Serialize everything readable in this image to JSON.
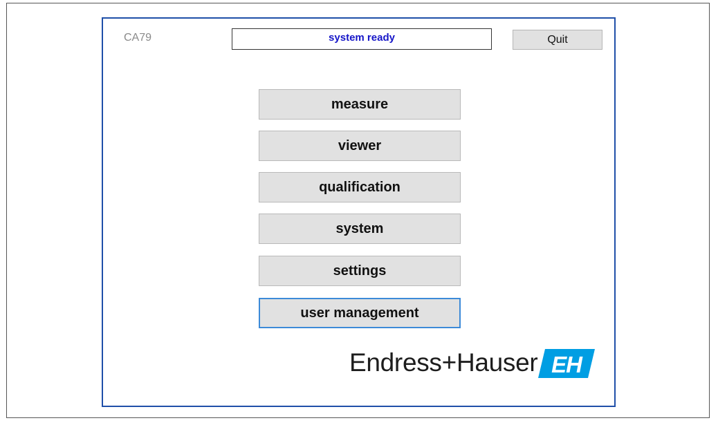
{
  "app": {
    "title": "CA79",
    "status": "system ready",
    "quit_label": "Quit"
  },
  "menu": {
    "items": [
      {
        "label": "measure"
      },
      {
        "label": "viewer"
      },
      {
        "label": "qualification"
      },
      {
        "label": "system"
      },
      {
        "label": "settings"
      },
      {
        "label": "user management"
      }
    ]
  },
  "branding": {
    "company": "Endress+Hauser",
    "logo_text": "EH",
    "logo_color": "#009ee3"
  },
  "colors": {
    "window_border": "#1f4fa8",
    "status_text": "#1515c8",
    "button_bg": "#e1e1e1",
    "focus_border": "#3c8ad8"
  }
}
